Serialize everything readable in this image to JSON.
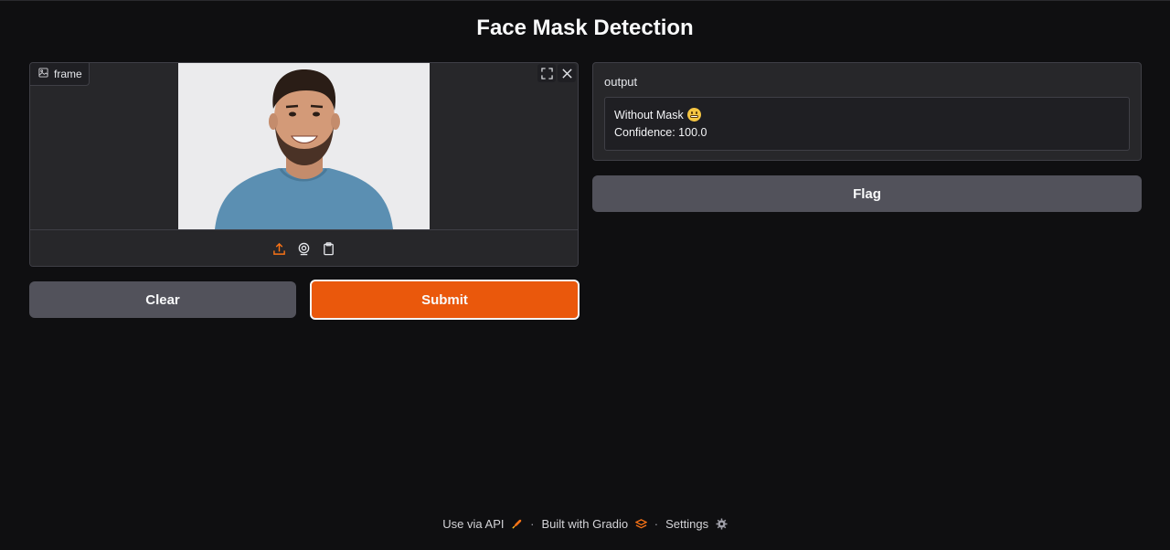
{
  "app": {
    "title": "Face Mask Detection"
  },
  "input_panel": {
    "label": "frame",
    "tools": [
      "fullscreen-icon",
      "close-icon"
    ],
    "sources": [
      "upload-icon",
      "webcam-icon",
      "clipboard-icon"
    ],
    "active_source_color": "#f97316"
  },
  "output_panel": {
    "label": "output",
    "result_line": "Without Mask",
    "confidence_line": "Confidence: 100.0"
  },
  "buttons": {
    "clear": "Clear",
    "submit": "Submit",
    "flag": "Flag"
  },
  "colors": {
    "accent": "#ea580c",
    "background": "#0f0f11",
    "panel": "#27272a",
    "secondary_button": "#52525b"
  },
  "footer": {
    "api": "Use via API",
    "built": "Built with Gradio",
    "settings": "Settings",
    "separator": "·"
  }
}
